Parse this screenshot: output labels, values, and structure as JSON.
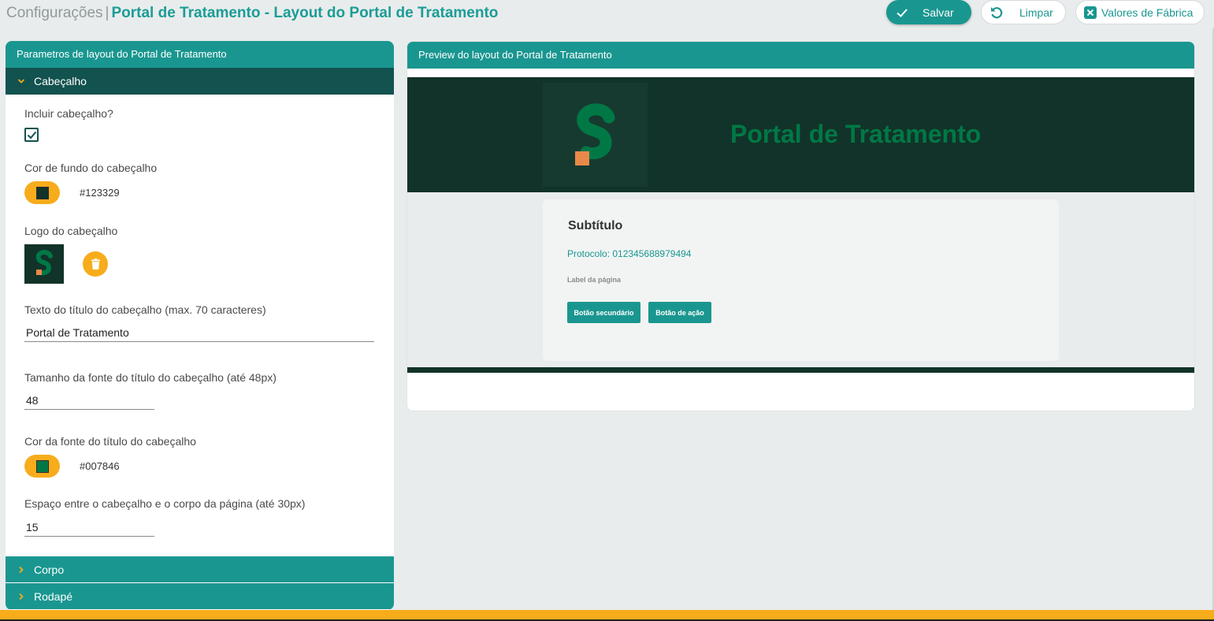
{
  "header": {
    "breadcrumb_base": "Configurações",
    "separator": "|",
    "title": "Portal de Tratamento - Layout do Portal de Tratamento",
    "save_label": "Salvar",
    "clear_label": "Limpar",
    "factory_label": "Valores de Fábrica"
  },
  "left": {
    "panel_title": "Parametros de layout do Portal de Tratamento",
    "sections": {
      "header": "Cabeçalho",
      "body": "Corpo",
      "footer": "Rodapé"
    },
    "fields": {
      "include_header_label": "Incluir cabeçalho?",
      "include_header_checked": true,
      "bg_color_label": "Cor de fundo do cabeçalho",
      "bg_color_value": "#123329",
      "logo_label": "Logo do cabeçalho",
      "title_text_label": "Texto do título do cabeçalho (max. 70 caracteres)",
      "title_text_value": "Portal de Tratamento",
      "font_size_label": "Tamanho da fonte do título do cabeçalho (até 48px)",
      "font_size_value": "48",
      "font_color_label": "Cor da fonte do título do cabeçalho",
      "font_color_value": "#007846",
      "spacing_label": "Espaço entre o cabeçalho e o corpo da página (até 30px)",
      "spacing_value": "15"
    }
  },
  "right": {
    "panel_title": "Preview do layout do Portal de Tratamento",
    "preview": {
      "header_title": "Portal de Tratamento",
      "subtitle": "Subtítulo",
      "protocol": "Protocolo: 012345688979494",
      "page_label": "Label da página",
      "secondary_button": "Botão secundário",
      "action_button": "Botão de ação"
    }
  },
  "colors": {
    "accent": "#1a9690",
    "dark": "#123329",
    "brand_green": "#007846",
    "orange": "#f7ac1b",
    "logo_orange": "#e8894a"
  },
  "icons": {
    "save": "check-icon",
    "clear": "undo-icon",
    "factory": "close-box-icon",
    "section_open": "chevron-down-icon",
    "section_closed": "chevron-right-icon",
    "delete": "trash-icon"
  }
}
